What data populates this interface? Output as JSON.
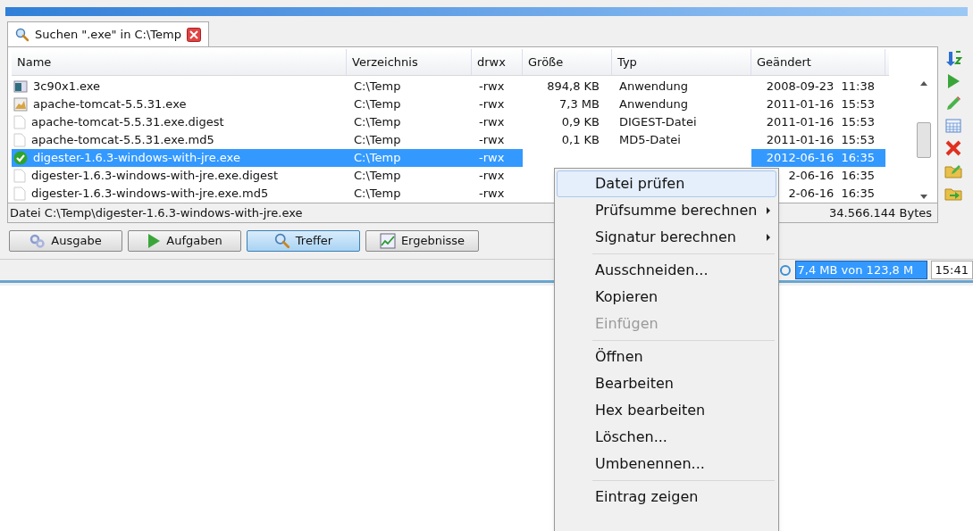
{
  "progress": {
    "level": 1
  },
  "tab": {
    "label": "Suchen \".exe\" in C:\\Temp",
    "selected": true
  },
  "table": {
    "columns": [
      "Name",
      "Verzeichnis",
      "drwx",
      "Größe",
      "Typ",
      "Geändert"
    ],
    "rows": [
      {
        "kind": "app",
        "name": "3c90x1.exe",
        "dir": "C:\\Temp",
        "perm": "-rwx",
        "size": "894,8 KB",
        "type": "Anwendung",
        "modified": "2008-09-23  11:38",
        "selected": false
      },
      {
        "kind": "tomcat",
        "name": "apache-tomcat-5.5.31.exe",
        "dir": "C:\\Temp",
        "perm": "-rwx",
        "size": "7,3 MB",
        "type": "Anwendung",
        "modified": "2011-01-16  15:53",
        "selected": false
      },
      {
        "kind": "file",
        "name": "apache-tomcat-5.5.31.exe.digest",
        "dir": "C:\\Temp",
        "perm": "-rwx",
        "size": "0,9 KB",
        "type": "DIGEST-Datei",
        "modified": "2011-01-16  15:53",
        "selected": false
      },
      {
        "kind": "file",
        "name": "apache-tomcat-5.5.31.exe.md5",
        "dir": "C:\\Temp",
        "perm": "-rwx",
        "size": "0,1 KB",
        "type": "MD5-Datei",
        "modified": "2011-01-16  15:53",
        "selected": false
      },
      {
        "kind": "check",
        "name": "digester-1.6.3-windows-with-jre.exe",
        "dir": "C:\\Temp",
        "perm": "-rwx",
        "modified": "2012-06-16  16:35",
        "selected": true
      },
      {
        "kind": "file",
        "name": "digester-1.6.3-windows-with-jre.exe.digest",
        "dir": "C:\\Temp",
        "perm": "-rwx",
        "modified": "2-06-16  16:35",
        "selected": false
      },
      {
        "kind": "file",
        "name": "digester-1.6.3-windows-with-jre.exe.md5",
        "dir": "C:\\Temp",
        "perm": "-rwx",
        "modified": "2-06-16  16:35",
        "selected": false
      }
    ]
  },
  "file_status": {
    "path": "Datei C:\\Temp\\digester-1.6.3-windows-with-jre.exe",
    "bytes": "34.566.144 Bytes"
  },
  "view_buttons": [
    {
      "kind": "output",
      "label": "Ausgabe",
      "selected": false
    },
    {
      "kind": "play",
      "label": "Aufgaben",
      "selected": false
    },
    {
      "kind": "search",
      "label": "Treffer",
      "selected": true
    },
    {
      "kind": "chart",
      "label": "Ergebnisse",
      "selected": false
    }
  ],
  "status_bar": {
    "memory": "7,4 MB von 123,8 M",
    "time": "15:41"
  },
  "context_menu": [
    {
      "kind": "item",
      "label": "Datei prüfen",
      "selected": true,
      "disabled": false,
      "submenu": false
    },
    {
      "kind": "item",
      "label": "Prüfsumme berechnen",
      "selected": false,
      "disabled": false,
      "submenu": true
    },
    {
      "kind": "item",
      "label": "Signatur berechnen",
      "selected": false,
      "disabled": false,
      "submenu": true
    },
    {
      "kind": "separator"
    },
    {
      "kind": "item",
      "label": "Ausschneiden...",
      "selected": false,
      "disabled": false,
      "submenu": false
    },
    {
      "kind": "item",
      "label": "Kopieren",
      "selected": false,
      "disabled": false,
      "submenu": false
    },
    {
      "kind": "item",
      "label": "Einfügen",
      "selected": false,
      "disabled": true,
      "submenu": false
    },
    {
      "kind": "separator"
    },
    {
      "kind": "item",
      "label": "Öffnen",
      "selected": false,
      "disabled": false,
      "submenu": false
    },
    {
      "kind": "item",
      "label": "Bearbeiten",
      "selected": false,
      "disabled": false,
      "submenu": false
    },
    {
      "kind": "item",
      "label": "Hex bearbeiten",
      "selected": false,
      "disabled": false,
      "submenu": false
    },
    {
      "kind": "item",
      "label": "Löschen...",
      "selected": false,
      "disabled": false,
      "submenu": false
    },
    {
      "kind": "item",
      "label": "Umbenennen...",
      "selected": false,
      "disabled": false,
      "submenu": false
    },
    {
      "kind": "separator"
    },
    {
      "kind": "item",
      "label": "Eintrag zeigen",
      "selected": false,
      "disabled": false,
      "submenu": false
    }
  ]
}
